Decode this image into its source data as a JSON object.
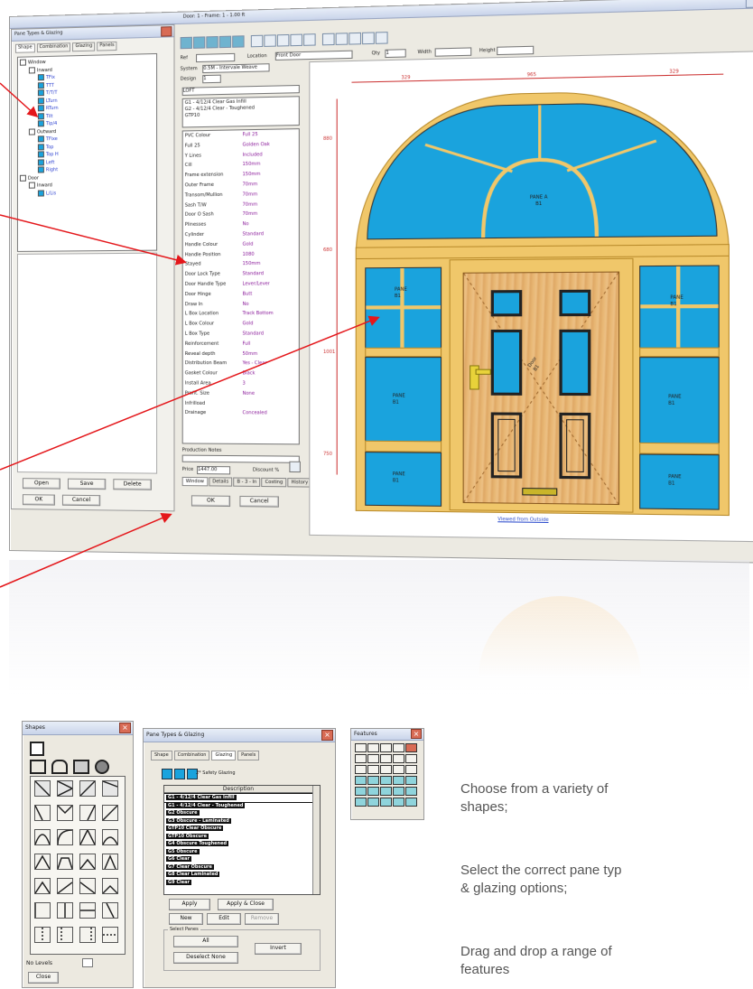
{
  "main_window": {
    "title": "Door: 1  -  Frame: 1 - 1.00 ft",
    "toolbar_icons": [
      "new-icon",
      "save-icon",
      "frame-icon",
      "pane-icon",
      "grid-icon",
      "shape-icon",
      "glazing-icon",
      "feature-icon",
      "undo-icon",
      "zoom-in-icon",
      "zoom-out-icon",
      "print-icon",
      "copy-icon",
      "paste-icon",
      "help-icon"
    ],
    "fields": {
      "ref_label": "Ref",
      "location_label": "Location",
      "location_value": "Front Door",
      "qty_label": "Qty",
      "qty_value": "1",
      "width_label": "Width",
      "height_label": "Height",
      "system_label": "System",
      "system_value": "0.5M - Intervale Weave",
      "design_label": "Design",
      "design_value": "1",
      "code_value": "LOFT"
    },
    "glass_lines": [
      "G1 - 4/12/4 Clear Gas Infill",
      "G2 - 4/12/4 Clear - Toughened",
      "GTP10"
    ],
    "properties": [
      [
        "PVC Colour",
        "Full 25"
      ],
      [
        "Full 25",
        "Golden Oak"
      ],
      [
        "Y Lines",
        "Included"
      ],
      [
        "Cill",
        "150mm"
      ],
      [
        "Frame extension",
        "150mm"
      ],
      [
        "Outer Frame",
        "70mm"
      ],
      [
        "Transom/Mullion",
        "70mm"
      ],
      [
        "Sash T/W",
        "70mm"
      ],
      [
        "Door O Sash",
        "70mm"
      ],
      [
        "Plinesses",
        "No"
      ],
      [
        "Cylinder",
        "Standard"
      ],
      [
        "Handle Colour",
        "Gold"
      ],
      [
        "Handle Position",
        "1080"
      ],
      [
        "Stayed",
        "150mm"
      ],
      [
        "Door Lock Type",
        "Standard"
      ],
      [
        "Door Handle Type",
        "Lever/Lever"
      ],
      [
        "Door Hinge",
        "Butt"
      ],
      [
        "Draw In",
        "No"
      ],
      [
        "L Box Location",
        "Track Bottom"
      ],
      [
        "L Box Colour",
        "Gold"
      ],
      [
        "L Box Type",
        "Standard"
      ],
      [
        "Reinforcement",
        "Full"
      ],
      [
        "Reveal depth",
        "50mm"
      ],
      [
        "Distribution Beam",
        "Yes - Clear"
      ],
      [
        "Gasket Colour",
        "Black"
      ],
      [
        "Install Area",
        "3"
      ],
      [
        "Profit. Size",
        "None"
      ],
      [
        "Infrilload",
        ""
      ],
      [
        "Drainage",
        "Concealed"
      ]
    ],
    "production_notes_label": "Production Notes",
    "price_label": "Price",
    "price_value": "1447.00",
    "discount_label": "Discount %",
    "tabs": [
      "Window",
      "Details",
      "B - 3 - In",
      "Costing",
      "History"
    ],
    "ok_label": "OK",
    "cancel_label": "Cancel",
    "dim_top": [
      "329",
      "965",
      "329"
    ],
    "dim_left": [
      "880",
      "680",
      "1001",
      "750"
    ],
    "pane_labels": {
      "fanlight": "PANE A\nB1",
      "left_top": "PANE\nB1",
      "right_top": "PANE\nB1",
      "left_mid": "PANE\nB1",
      "right_mid": "PANE\nB1",
      "left_bot": "PANE\nB1",
      "right_bot": "PANE\nB1",
      "door": "Door\nB1"
    },
    "footer_link": "Viewed from Outside"
  },
  "left_panel": {
    "title": "Pane Types & Glazing",
    "tabs": [
      "Shape",
      "Combination",
      "Glazing",
      "Panels"
    ],
    "tree": [
      "Window",
      "Inward",
      "TFix",
      "TTT",
      "T/T/T",
      "LTurn",
      "RTurn",
      "Tilt",
      "Tip/4",
      "Outward",
      "TFixe",
      "Top",
      "Top H",
      "Left",
      "Right",
      "Door",
      "Inward",
      "L/Lis"
    ],
    "open_label": "Open",
    "save_label": "Save",
    "delete_label": "Delete",
    "ok_label": "OK",
    "cancel_label": "Cancel"
  },
  "shapes_window": {
    "title": "Shapes",
    "no_levels_label": "No Levels",
    "close_label": "Close"
  },
  "pane_window": {
    "title": "Pane Types & Glazing",
    "tabs": [
      "Shape",
      "Combination",
      "Glazing",
      "Panels"
    ],
    "checkbox_label": "2* Safety Glazing",
    "description_header": "Description",
    "rows": [
      "G1 - 4/12/4 Clear Gas Infill",
      "G1 - 4/12/4 Clear - Toughened",
      "G2 Obscure",
      "G3 Obscure - Laminated",
      "GTP10 Clear Obscure",
      "GTP10 Obscure",
      "G4 Obscure Toughened",
      "G5 Obscure",
      "G6 Clear",
      "G7 Clear Obscure",
      "G8 Clear Laminated",
      "G9 Clear"
    ],
    "apply_label": "Apply",
    "apply_close_label": "Apply & Close",
    "new_label": "New",
    "edit_label": "Edit",
    "remove_label": "Remove",
    "select_options_label": "Select Panes",
    "all_label": "All",
    "deselect_label": "Deselect None",
    "invert_label": "Invert"
  },
  "features_window": {
    "title": "Features"
  },
  "captions": [
    "Choose from a variety of\nshapes;",
    "Select the correct pane typ\n& glazing options;",
    "Drag and drop a range of\nfeatures"
  ],
  "colors": {
    "arrow": "#e4171b",
    "glass": "#1aa3dd",
    "frame": "#f0c76a",
    "door_wood": "#e8b774",
    "caption_text": "#555555"
  }
}
